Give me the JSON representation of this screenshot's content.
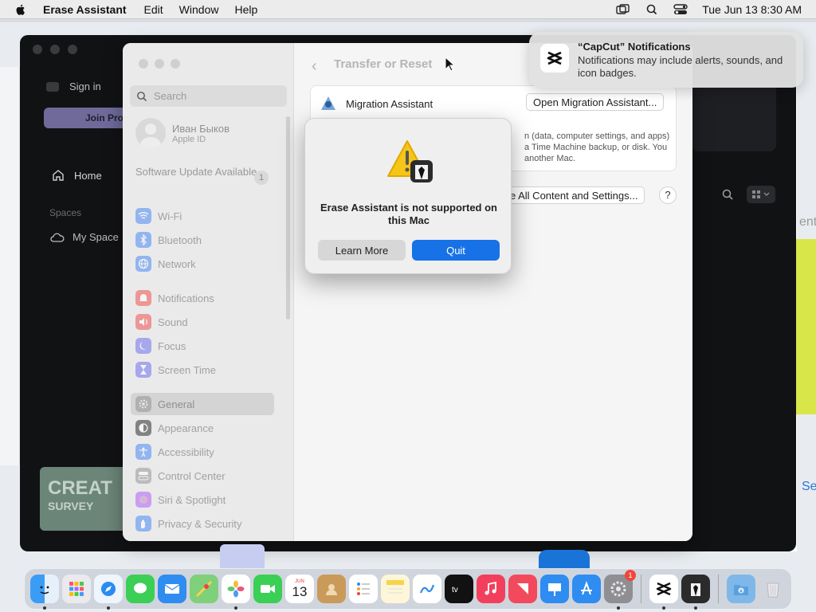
{
  "menubar": {
    "app_name": "Erase Assistant",
    "items": [
      "Edit",
      "Window",
      "Help"
    ],
    "datetime": "Tue Jun 13  8:30 AM"
  },
  "background_app": {
    "sign_in": "Sign in",
    "join": "Join Pro",
    "home": "Home",
    "spaces": "Spaces",
    "my_space": "My Space",
    "banner_title": "CREAT",
    "banner_sub": "SURVEY",
    "side_text_right": "ent.",
    "side_link_right": "Se"
  },
  "settings": {
    "search_placeholder": "Search",
    "profile_name": "Иван Быков",
    "profile_sub": "Apple ID",
    "software_update": "Software Update Available",
    "software_update_count": "1",
    "sidebar": [
      {
        "label": "Wi-Fi",
        "icon": "wifi-icon",
        "color": "#3b82f6"
      },
      {
        "label": "Bluetooth",
        "icon": "bluetooth-icon",
        "color": "#3b82f6"
      },
      {
        "label": "Network",
        "icon": "globe-icon",
        "color": "#3b82f6"
      },
      {
        "label": "Notifications",
        "icon": "bell-icon",
        "color": "#ef4444"
      },
      {
        "label": "Sound",
        "icon": "speaker-icon",
        "color": "#ef4444"
      },
      {
        "label": "Focus",
        "icon": "moon-icon",
        "color": "#6366f1"
      },
      {
        "label": "Screen Time",
        "icon": "hourglass-icon",
        "color": "#6366f1"
      },
      {
        "label": "General",
        "icon": "gear-icon",
        "color": "#8e8e93"
      },
      {
        "label": "Appearance",
        "icon": "appearance-icon",
        "color": "#1c1c1e"
      },
      {
        "label": "Accessibility",
        "icon": "accessibility-icon",
        "color": "#3b82f6"
      },
      {
        "label": "Control Center",
        "icon": "control-center-icon",
        "color": "#8e8e93"
      },
      {
        "label": "Siri & Spotlight",
        "icon": "siri-icon",
        "color": "#a855f7"
      },
      {
        "label": "Privacy & Security",
        "icon": "hand-icon",
        "color": "#3b82f6"
      }
    ],
    "title": "Transfer or Reset",
    "migration_label": "Migration Assistant",
    "open_migration_button": "Open Migration Assistant...",
    "migration_desc": "n (data, computer settings, and apps) a Time Machine backup, or disk. You another Mac.",
    "erase_button": "e All Content and Settings...",
    "help_button": "?"
  },
  "alert": {
    "message": "Erase Assistant is not supported on this Mac",
    "learn_more": "Learn More",
    "quit": "Quit"
  },
  "notification": {
    "title": "“CapCut” Notifications",
    "body": "Notifications may include alerts, sounds, and icon badges."
  },
  "dock": {
    "calendar_month": "JUN",
    "calendar_day": "13",
    "settings_badge": "1",
    "apps": [
      "Finder",
      "Launchpad",
      "Safari",
      "Messages",
      "Mail",
      "Maps",
      "Photos",
      "FaceTime",
      "Calendar",
      "Contacts",
      "Reminders",
      "Notes",
      "Freeform",
      "TV",
      "Music",
      "News",
      "Keynote",
      "App Store",
      "System Settings",
      "CapCut",
      "Erase Assistant",
      "Downloads",
      "Trash"
    ]
  }
}
